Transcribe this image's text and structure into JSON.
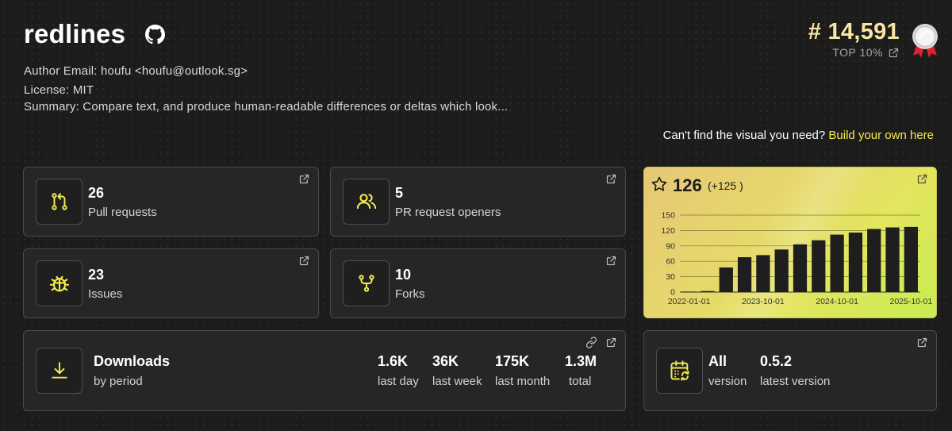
{
  "header": {
    "title": "redlines",
    "author": "Author Email: houfu <houfu@outlook.sg>",
    "license": "License: MIT",
    "summary": "Summary: Compare text, and produce human-readable differences or deltas which look..."
  },
  "rank": {
    "value": "# 14,591",
    "label": "TOP 10%"
  },
  "cta": {
    "text": "Can't find the visual you need?",
    "link": "Build your own here"
  },
  "stats": {
    "pull_requests": {
      "value": "26",
      "label": "Pull requests"
    },
    "pr_openers": {
      "value": "5",
      "label": "PR request openers"
    },
    "issues": {
      "value": "23",
      "label": "Issues"
    },
    "forks": {
      "value": "10",
      "label": "Forks"
    }
  },
  "stars": {
    "value": "126",
    "delta": "(+125 )"
  },
  "downloads": {
    "title": "Downloads",
    "subtitle": "by period",
    "items": [
      {
        "value": "1.6K",
        "label": "last day"
      },
      {
        "value": "36K",
        "label": "last week"
      },
      {
        "value": "175K",
        "label": "last month"
      },
      {
        "value": "1.3M",
        "label": "total"
      }
    ]
  },
  "version": {
    "all_value": "All",
    "all_label": "version",
    "latest_value": "0.5.2",
    "latest_label": "latest version"
  },
  "colors": {
    "accent": "#f5ec4e",
    "rank": "#f7e7a1",
    "card_bg": "#262626",
    "bar": "#1e1e1e"
  },
  "chart_data": {
    "type": "bar",
    "title": "",
    "xlabel": "",
    "ylabel": "",
    "ylim": [
      0,
      150
    ],
    "yticks": [
      "0",
      "30",
      "60",
      "90",
      "120",
      "150"
    ],
    "xticks": [
      "2022-01-01",
      "2023-10-01",
      "2024-10-01",
      "2025-10-01"
    ],
    "values": [
      1,
      2,
      48,
      68,
      72,
      83,
      93,
      101,
      112,
      116,
      123,
      126,
      127
    ],
    "grid": true
  }
}
